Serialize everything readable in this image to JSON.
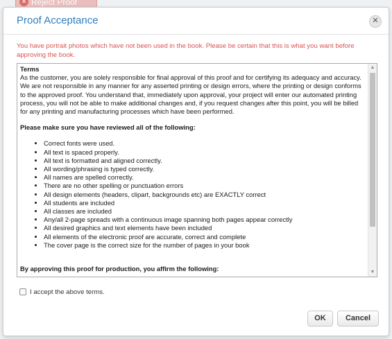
{
  "background_button": {
    "label": "Reject Proof"
  },
  "dialog": {
    "title": "Proof Acceptance",
    "warning": "You have portrait photos which have not been used in the book. Please be certain that this is what you want before approving the book.",
    "terms": {
      "heading": "Terms",
      "paragraph": "As the customer, you are solely responsible for final approval of this proof and for certifying its adequacy and accuracy. We are not responsible in any manner for any asserted printing or design errors, where the printing or design conforms to the approved proof. You understand that, immediately upon approval, your project will enter our automated printing process, you will not be able to make additional changes and, if you request changes after this point, you will be billed for any printing and manufacturing processes which have been performed.",
      "review_heading": "Please make sure you have reviewed all of the following:",
      "checklist": [
        "Correct fonts were used.",
        "All text is spaced properly.",
        "All text is formatted and aligned correctly.",
        "All wording/phrasing is typed correctly.",
        "All names are spelled correctly.",
        "There are no other spelling or punctuation errors",
        "All design elements (headers, clipart, backgrounds etc) are EXACTLY correct",
        "All students are included",
        "All classes are included",
        "Any/all 2-page spreads with a continuous image spanning both pages appear correctly",
        "All desired graphics and text elements have been included",
        "All elements of the electronic proof are accurate, correct and complete",
        "The cover page is the correct size for the number of pages in your book"
      ],
      "affirm_heading": "By approving this proof for production, you affirm the following:"
    },
    "accept_label": "I accept the above terms.",
    "accept_checked": false,
    "ok_label": "OK",
    "cancel_label": "Cancel"
  }
}
